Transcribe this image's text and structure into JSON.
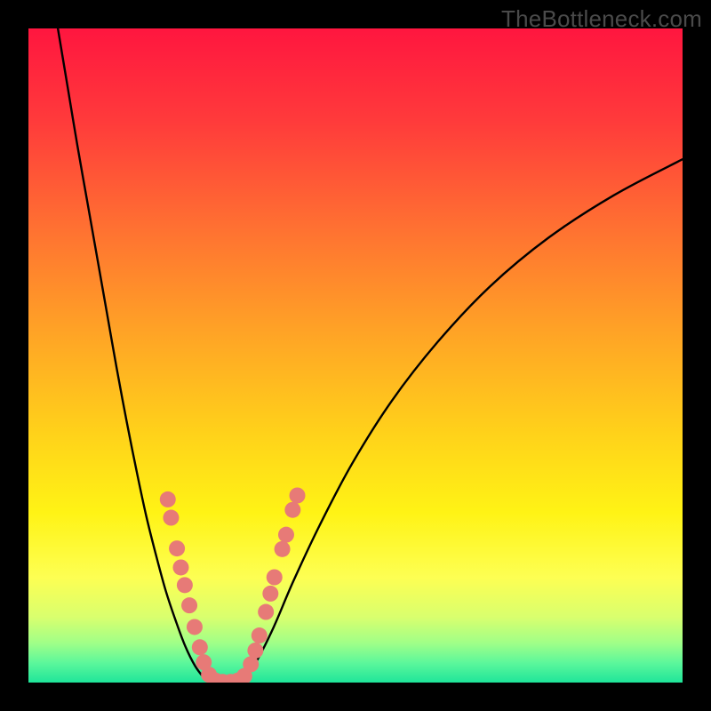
{
  "watermark": "TheBottleneck.com",
  "colors": {
    "frame": "#000000",
    "curve": "#000000",
    "marker": "#e77a77",
    "gradient_stops": [
      {
        "pct": 0,
        "color": "#ff163f"
      },
      {
        "pct": 14,
        "color": "#ff3a3b"
      },
      {
        "pct": 30,
        "color": "#ff6f32"
      },
      {
        "pct": 46,
        "color": "#ffa226"
      },
      {
        "pct": 62,
        "color": "#ffd21a"
      },
      {
        "pct": 74,
        "color": "#fff315"
      },
      {
        "pct": 84,
        "color": "#fdff53"
      },
      {
        "pct": 90,
        "color": "#d9ff6e"
      },
      {
        "pct": 94,
        "color": "#9fff88"
      },
      {
        "pct": 97,
        "color": "#5cf79b"
      },
      {
        "pct": 100,
        "color": "#1fe59a"
      }
    ]
  },
  "chart_data": {
    "type": "line",
    "title": "",
    "xlabel": "",
    "ylabel": "",
    "xlim": [
      0,
      1
    ],
    "ylim": [
      0,
      1
    ],
    "grid": false,
    "series": [
      {
        "name": "left-branch",
        "x": [
          0.045,
          0.06,
          0.075,
          0.09,
          0.105,
          0.12,
          0.135,
          0.15,
          0.165,
          0.18,
          0.195,
          0.21,
          0.225,
          0.24,
          0.255,
          0.27
        ],
        "y": [
          1.0,
          0.91,
          0.82,
          0.735,
          0.65,
          0.565,
          0.48,
          0.4,
          0.325,
          0.255,
          0.195,
          0.14,
          0.095,
          0.055,
          0.025,
          0.005
        ]
      },
      {
        "name": "valley-floor",
        "x": [
          0.27,
          0.29,
          0.31,
          0.33
        ],
        "y": [
          0.005,
          0.0,
          0.0,
          0.005
        ]
      },
      {
        "name": "right-branch",
        "x": [
          0.33,
          0.35,
          0.375,
          0.405,
          0.445,
          0.495,
          0.555,
          0.625,
          0.705,
          0.795,
          0.895,
          1.0
        ],
        "y": [
          0.005,
          0.035,
          0.085,
          0.155,
          0.24,
          0.335,
          0.43,
          0.52,
          0.605,
          0.68,
          0.745,
          0.8
        ]
      }
    ],
    "markers": {
      "name": "highlighted-points",
      "color": "#e77a77",
      "points": [
        {
          "x": 0.213,
          "y": 0.28,
          "r": 9
        },
        {
          "x": 0.218,
          "y": 0.252,
          "r": 9
        },
        {
          "x": 0.227,
          "y": 0.205,
          "r": 9
        },
        {
          "x": 0.233,
          "y": 0.176,
          "r": 9
        },
        {
          "x": 0.239,
          "y": 0.149,
          "r": 9
        },
        {
          "x": 0.246,
          "y": 0.118,
          "r": 9
        },
        {
          "x": 0.254,
          "y": 0.085,
          "r": 9
        },
        {
          "x": 0.262,
          "y": 0.054,
          "r": 9
        },
        {
          "x": 0.268,
          "y": 0.031,
          "r": 9
        },
        {
          "x": 0.276,
          "y": 0.012,
          "r": 9
        },
        {
          "x": 0.286,
          "y": 0.003,
          "r": 9
        },
        {
          "x": 0.297,
          "y": 0.001,
          "r": 9
        },
        {
          "x": 0.309,
          "y": 0.001,
          "r": 9
        },
        {
          "x": 0.32,
          "y": 0.003,
          "r": 9
        },
        {
          "x": 0.33,
          "y": 0.01,
          "r": 9
        },
        {
          "x": 0.34,
          "y": 0.028,
          "r": 9
        },
        {
          "x": 0.347,
          "y": 0.049,
          "r": 9
        },
        {
          "x": 0.353,
          "y": 0.072,
          "r": 9
        },
        {
          "x": 0.363,
          "y": 0.108,
          "r": 9
        },
        {
          "x": 0.37,
          "y": 0.136,
          "r": 9
        },
        {
          "x": 0.376,
          "y": 0.161,
          "r": 9
        },
        {
          "x": 0.388,
          "y": 0.204,
          "r": 9
        },
        {
          "x": 0.394,
          "y": 0.226,
          "r": 9
        },
        {
          "x": 0.404,
          "y": 0.264,
          "r": 9
        },
        {
          "x": 0.411,
          "y": 0.286,
          "r": 9
        }
      ]
    }
  }
}
